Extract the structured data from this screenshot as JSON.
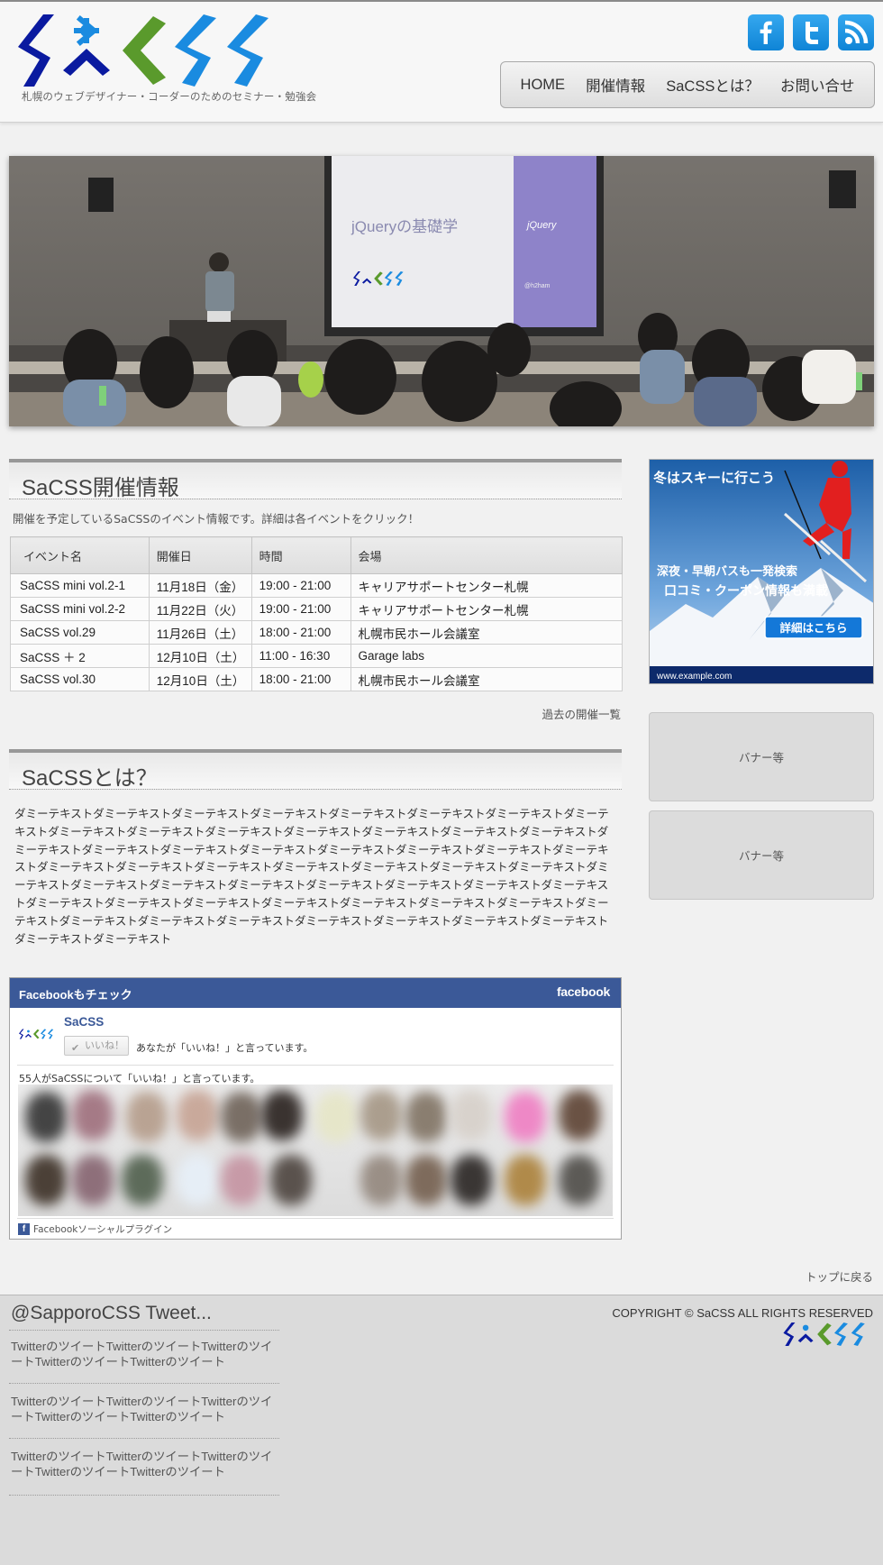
{
  "site": {
    "tagline": "札幌のウェブデザイナー・コーダーのためのセミナー・勉強会"
  },
  "social": [
    {
      "name": "facebook",
      "glyph": "f"
    },
    {
      "name": "twitter",
      "glyph": "t"
    },
    {
      "name": "rss",
      "glyph": "rss"
    }
  ],
  "nav": [
    "HOME",
    "開催情報",
    "SaCSSとは？",
    "お問い合せ"
  ],
  "hero": {
    "slide_title": "jQueryの基礎学",
    "slide_brand": "jQuery",
    "slide_handle": "@h2ham"
  },
  "events": {
    "title": "SaCSS開催情報",
    "lead": "開催を予定しているSaCSSのイベント情報です。詳細は各イベントをクリック！",
    "columns": [
      "イベント名",
      "開催日",
      "時間",
      "会場"
    ],
    "rows": [
      [
        "SaCSS mini vol.2-1",
        "11月18日（金）",
        "19:00 - 21:00",
        "キャリアサポートセンター札幌"
      ],
      [
        "SaCSS mini vol.2-2",
        "11月22日（火）",
        "19:00 - 21:00",
        "キャリアサポートセンター札幌"
      ],
      [
        "SaCSS vol.29",
        "11月26日（土）",
        "18:00 - 21:00",
        "札幌市民ホール会議室"
      ],
      [
        "SaCSS ＋ 2",
        "12月10日（土）",
        "11:00 - 16:30",
        "Garage labs"
      ],
      [
        "SaCSS vol.30",
        "12月10日（土）",
        "18:00 - 21:00",
        "札幌市民ホール会議室"
      ]
    ],
    "past_link": "過去の開催一覧"
  },
  "about": {
    "title": "SaCSSとは？",
    "body": "ダミーテキストダミーテキストダミーテキストダミーテキストダミーテキストダミーテキストダミーテキストダミーテキストダミーテキストダミーテキストダミーテキストダミーテキストダミーテキストダミーテキストダミーテキストダミーテキストダミーテキストダミーテキストダミーテキストダミーテキストダミーテキストダミーテキストダミーテキストダミーテキストダミーテキストダミーテキストダミーテキストダミーテキストダミーテキストダミーテキストダミーテキストダミーテキストダミーテキストダミーテキストダミーテキストダミーテキストダミーテキストダミーテキストダミーテキストダミーテキストダミーテキストダミーテキストダミーテキストダミーテキストダミーテキストダミーテキストダミーテキストダミーテキストダミーテキストダミーテキストダミーテキストダミーテキストダミーテキストダミーテキストダミーテキスト"
  },
  "facebook": {
    "header": "Facebookもチェック",
    "brand": "facebook",
    "page_name": "SaCSS",
    "like_button": "いいね！",
    "like_text": "あなたが「いいね！」と言っています。",
    "count_text": "55人がSaCSSについて「いいね！」と言っています。",
    "plugin": "Facebookソーシャルプラグイン"
  },
  "back_to_top": "トップに戻る",
  "ad": {
    "headline": "冬はスキーに行こう",
    "line1": "深夜・早朝バスも一発検索",
    "line2": "口コミ・クーポン情報も満載",
    "cta": "詳細はこちら",
    "url": "www.example.com"
  },
  "banners": [
    "バナー等",
    "バナー等"
  ],
  "footer": {
    "twitter_title": "@SapporoCSS Tweet...",
    "tweets": [
      "TwitterのツイートTwitterのツイートTwitterのツイートTwitterのツイートTwitterのツイート",
      "TwitterのツイートTwitterのツイートTwitterのツイートTwitterのツイートTwitterのツイート",
      "TwitterのツイートTwitterのツイートTwitterのツイートTwitterのツイートTwitterのツイート"
    ],
    "copyright": "COPYRIGHT © SaCSS ALL RIGHTS RESERVED"
  },
  "colors": {
    "logo_navy": "#0a1aa0",
    "logo_blue": "#1a8be0",
    "logo_green": "#5a9a2c",
    "facebook_blue": "#3b5998",
    "social_blue": "#1a93e4"
  }
}
